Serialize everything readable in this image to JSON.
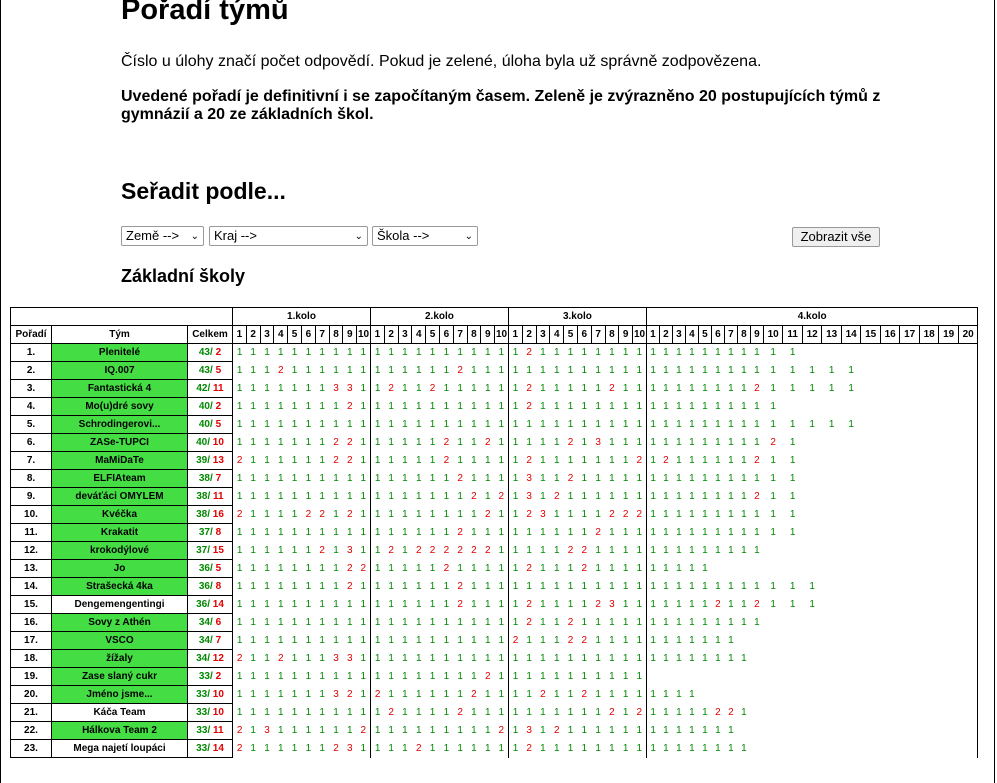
{
  "title": "Pořadí týmů",
  "intro": "Číslo u úlohy značí počet odpovědí. Pokud je zelené, úloha byla už správně zodpovězena.",
  "notice": "Uvedené pořadí je definitivní i se započítaným časem. Zeleně je zvýrazněno 20 postupujících týmů z gymnázií a 20 ze základních škol.",
  "sort_heading": "Seřadit podle...",
  "filters": {
    "country": "Země -->",
    "region": "Kraj -->",
    "school": "Škola -->",
    "show_all": "Zobrazit vše"
  },
  "section_heading": "Základní školy",
  "table": {
    "col_rank": "Pořadí",
    "col_team": "Tým",
    "col_total": "Celkem",
    "rounds": [
      {
        "label": "1.kolo",
        "count": 10
      },
      {
        "label": "2.kolo",
        "count": 10
      },
      {
        "label": "3.kolo",
        "count": 10
      },
      {
        "label": "4.kolo",
        "count": 20
      }
    ],
    "rows": [
      {
        "rank": "1.",
        "team": "Plenitelé",
        "green": true,
        "correct": "43",
        "wrong": "2",
        "cells": "1111111111 1111111111 1211 1111 11 11111 1 1 111 1"
      },
      {
        "rank": "2.",
        "team": "IQ.007",
        "green": true,
        "correct": "43",
        "wrong": "5",
        "cells": "1112111111 1111112111 1111 1111 1 1111111 1 1 111111"
      },
      {
        "rank": "3.",
        "team": "Fantastická 4",
        "green": true,
        "correct": "42",
        "wrong": "11",
        "cells": "1111111331 1211211111 12111112 1 1 11111 11 12 11111"
      },
      {
        "rank": "4.",
        "team": "Mo(u)dré sovy",
        "green": true,
        "correct": "40",
        "wrong": "2",
        "cells": "1111111121 1111111111 1211111111 1 111 1 1 1 1 1 1"
      },
      {
        "rank": "5.",
        "team": "Schrodingerovi...",
        "green": true,
        "correct": "40",
        "wrong": "5",
        "cells": "1111111111 1111111111 1111111111 1 1111111111 1 1 1"
      },
      {
        "rank": "6.",
        "team": "ZASe-TUPCI",
        "green": true,
        "correct": "40",
        "wrong": "10",
        "cells": "1111111221 1111121121 1111 2131 1 1111111 11 1 2 1"
      },
      {
        "rank": "7.",
        "team": "MaMiDaTe",
        "green": true,
        "correct": "39",
        "wrong": "13",
        "cells": "2111111221 1111121111 1211 1111 1212 1111 1 1 211"
      },
      {
        "rank": "8.",
        "team": "ELFIAteam",
        "green": true,
        "correct": "38",
        "wrong": "7",
        "cells": "1111111111 1111112111 1311 2 1111 11 111 11 1 1111"
      },
      {
        "rank": "9.",
        "team": "deváťáci OMYLEM",
        "green": true,
        "correct": "38",
        "wrong": "11",
        "cells": "1111111111 1111111212 1312111 1 1111111 11 1 211"
      },
      {
        "rank": "10.",
        "team": "Kvéčka",
        "green": true,
        "correct": "38",
        "wrong": "16",
        "cells": "2111122121 1111111121 1231111222 11111111 1 1 1"
      },
      {
        "rank": "11.",
        "team": "Krakatit",
        "green": true,
        "correct": "37",
        "wrong": "8",
        "cells": "1111111111 1111112111 1111 11 2 11 1111111 1 1111"
      },
      {
        "rank": "12.",
        "team": "krokodýlové",
        "green": true,
        "correct": "37",
        "wrong": "15",
        "cells": "1111112131 1212222221 1111 2211 1111111 1 1 1 1"
      },
      {
        "rank": "13.",
        "team": "Jo",
        "green": true,
        "correct": "36",
        "wrong": "5",
        "cells": "1111111122 1111121111 1 211 1 2 1 1 111 1 1 1 1"
      },
      {
        "rank": "14.",
        "team": "Strašecká 4ka",
        "green": true,
        "correct": "36",
        "wrong": "8",
        "cells": "1111111121 1111112111 1111111111 111111 1 1 1111"
      },
      {
        "rank": "15.",
        "team": "Dengemengentingi",
        "green": false,
        "correct": "36",
        "wrong": "14",
        "cells": "1111111111 1111112111 1211112311 1111 12 1 1 2111"
      },
      {
        "rank": "16.",
        "team": "Sovy z Athén",
        "green": true,
        "correct": "34",
        "wrong": "6",
        "cells": "1111111111 1111111111 1211 2111 1 1 111 1 1 1111"
      },
      {
        "rank": "17.",
        "team": "VSCO",
        "green": true,
        "correct": "34",
        "wrong": "7",
        "cells": "1111111 11 1111111111 1211 1221 1 11 1 1 1 1 1 11"
      },
      {
        "rank": "18.",
        "team": "žížaly",
        "green": true,
        "correct": "34",
        "wrong": "12",
        "cells": "2112111331 1111111111 1111111111 1 1 1 1 1 1 11"
      },
      {
        "rank": "19.",
        "team": "Zase slaný cukr",
        "green": true,
        "correct": "33",
        "wrong": "2",
        "cells": "1111111111 1111 1 1 112 1 11 111 1 1 1 1 1"
      },
      {
        "rank": "20.",
        "team": "Jméno jsme...",
        "green": true,
        "correct": "33",
        "wrong": "10",
        "cells": "1111111321 2111 11121 111 2 11 2 1 1 1 1 1 1 1 1"
      },
      {
        "rank": "21.",
        "team": "Káča Team",
        "green": false,
        "correct": "33",
        "wrong": "10",
        "cells": "1111111111 121111 21 1111 1111 1 21211 1 1 1 22 1"
      },
      {
        "rank": "22.",
        "team": "Hálkova Team 2",
        "green": true,
        "correct": "33",
        "wrong": "11",
        "cells": "2131111112 1111111112 1312111111 11 1 1 1 1 1"
      },
      {
        "rank": "23.",
        "team": "Mega najetí loupáci",
        "green": false,
        "correct": "33",
        "wrong": "14",
        "cells": "2111111231 1112 1111 1112 111 1 1111 11 11 1 1 1 1"
      }
    ]
  },
  "colors": {
    "green_bg": "#44dd44",
    "correct": "#008800",
    "wrong": "#e00000"
  }
}
